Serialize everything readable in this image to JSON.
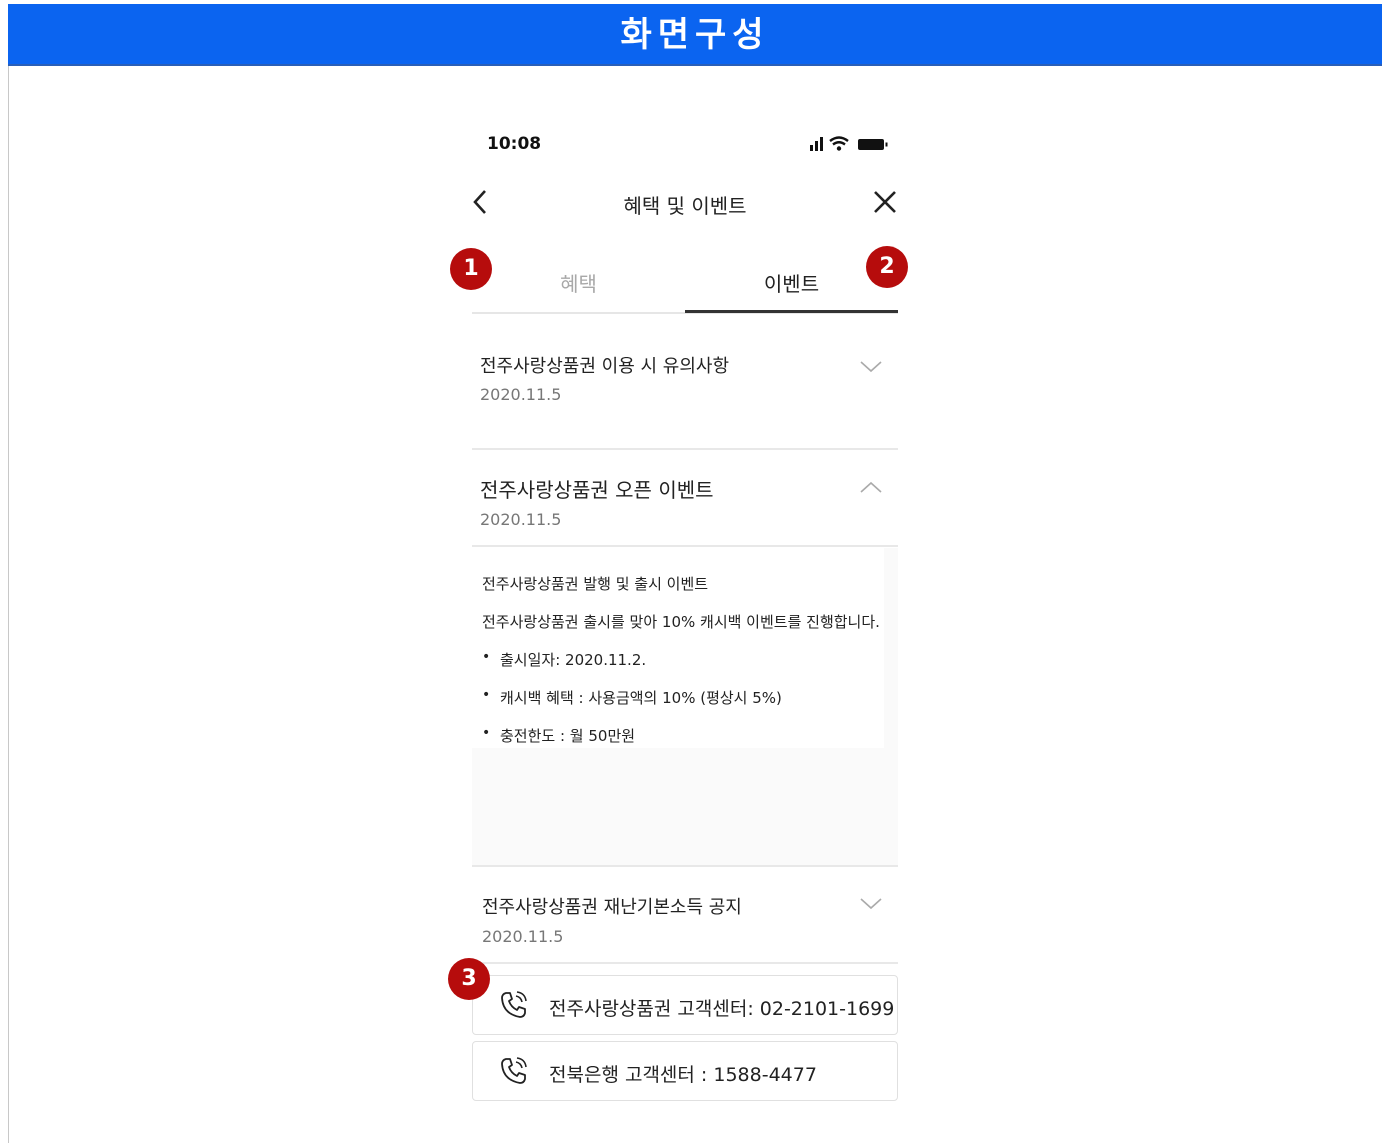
{
  "banner": {
    "title": "화면구성"
  },
  "status_bar": {
    "time": "10:08"
  },
  "header": {
    "title": "혜택 및 이벤트"
  },
  "tabs": [
    {
      "label": "혜택",
      "active": false
    },
    {
      "label": "이벤트",
      "active": true
    }
  ],
  "badges": [
    "1",
    "2",
    "3"
  ],
  "notices": [
    {
      "title": "전주사랑상품권 이용 시 유의사항",
      "date": "2020.11.5",
      "expanded": false
    },
    {
      "title": "전주사랑상품권 오픈 이벤트",
      "date": "2020.11.5",
      "expanded": true
    },
    {
      "title": "전주사랑상품권 재난기본소득 공지",
      "date": "2020.11.5",
      "expanded": false
    }
  ],
  "event_detail": {
    "heading": "전주사랑상품권 발행 및 출시 이벤트",
    "body": "전주사랑상품권 출시를 맞아 10% 캐시백 이벤트를 진행합니다.",
    "bullets": [
      "출시일자: 2020.11.2.",
      "캐시백 혜택 : 사용금액의 10% (평상시 5%)",
      "충전한도 : 월 50만원"
    ]
  },
  "contacts": [
    {
      "label": "전주사랑상품권 고객센터: 02-2101-1699"
    },
    {
      "label": "전북은행 고객센터 : 1588-4477"
    }
  ],
  "colors": {
    "banner": "#0b64f0",
    "badge": "#b60c0c"
  }
}
